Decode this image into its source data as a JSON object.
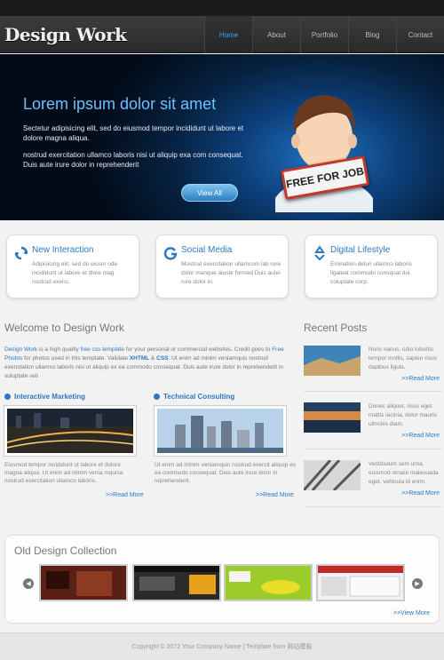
{
  "header": {
    "logo": "Design Work",
    "nav": [
      "Home",
      "About",
      "Portfolio",
      "Blog",
      "Contact"
    ]
  },
  "hero": {
    "title": "Lorem ipsum dolor sit amet",
    "paragraph1": "Sectetur adipisicing elit, sed do eiusmod tempor incididunt ut labore et dolore magna aliqua.",
    "paragraph2": "nostrud exercitation ullamco laboris nisi ut aliquip exa com consequat. Duis aute irure dolor in reprehenderit",
    "button": "View All",
    "sign": "FREE FOR JOB"
  },
  "features": [
    {
      "title": "New Interaction",
      "text": "Adipisicing elit, sed do eiusm ode incididunt ut labore et dlore mag nostrud exerci.",
      "icon": "recycle-arrows-icon"
    },
    {
      "title": "Social Media",
      "text": "Mostrud exercitation ullamcom lab rure dolor manque aluste formed Duis autei rure dolor in.",
      "icon": "g-arrow-icon"
    },
    {
      "title": "Digital Lifestyle",
      "text": "Emination deluri ullamco laboris ligaleat commodo consquat dui coluptate corp.",
      "icon": "recycle-icon"
    }
  ],
  "welcome": {
    "title": "Welcome to Design Work",
    "text_parts": {
      "link1": "Design Work",
      "t1": " is a high quality ",
      "link2": "free css template",
      "t2": " for your personal or commercial websites. Credit goes to ",
      "link3": "Free Photos",
      "t3": " for photos used in this template. Validate ",
      "xhtml": "XHTML",
      "amp": " & ",
      "css": "CSS",
      "t4": ". Ut enim ad minim veniamquis nostrud exercitation ullamco laboris nisi ut aliquip ex ea commodo consequat. Duis aute irure dolor in reprehenderit in voluptate veli"
    }
  },
  "columns": [
    {
      "heading": "Interactive Marketing",
      "text": "Eiusmod tempor incididunt ut labore et dolore magna aliqua. Ut enim ad minim venia mquisa nostrud exercitation ullamco laboris.",
      "more": ">>Read More"
    },
    {
      "heading": "Technical Consulting",
      "text": "Ut enim ad minim veniamquis nostrud exercit aliquip ex ea commodo consequat. Duis aute irure dolor in reprehenderit.",
      "more": ">>Read More"
    }
  ],
  "recent": {
    "title": "Recent Posts",
    "posts": [
      {
        "text": "Nunc varius, odio lobortis tempor mollis, sapien risus dapibus ligula.",
        "more": ">>Read More"
      },
      {
        "text": "Donec aliquet, risus eget mattis lacinia, dolor mauris ultricies diam.",
        "more": ">>Read More"
      },
      {
        "text": "Vestibulum sem urna, euismod ornare malesuada eget, vehicula id enim.",
        "more": ">>Read More"
      }
    ]
  },
  "collection": {
    "title": "Old Design Collection",
    "view_more": ">>View More",
    "prev_icon": "arrow-left-icon",
    "next_icon": "arrow-right-icon"
  },
  "footer": {
    "text": "Copyright © 2072 Your Company Name | Template from 网站模板"
  },
  "colors": {
    "accent": "#2c78c5",
    "header": "#2e2e2e",
    "hero_blue": "#1e73c4"
  }
}
